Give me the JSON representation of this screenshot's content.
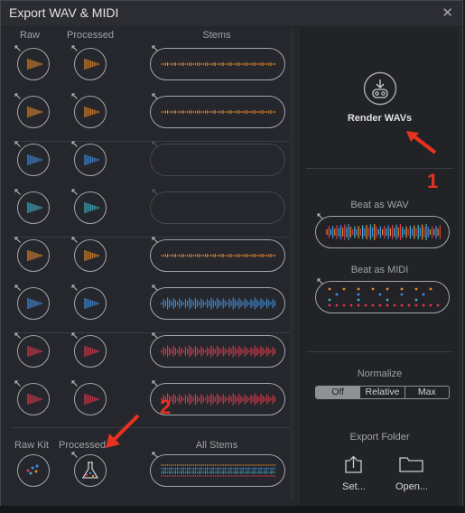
{
  "dialog": {
    "title": "Export WAV & MIDI",
    "close_icon": "close-icon"
  },
  "columns": {
    "raw": "Raw",
    "processed": "Processed",
    "stems": "Stems"
  },
  "rows": [
    {
      "color": "#e8892b",
      "stem": true
    },
    {
      "color": "#e8892b",
      "stem": true
    },
    {
      "color": "#3f8fe0",
      "stem": false
    },
    {
      "color": "#3fb6c9",
      "stem": false
    },
    {
      "color": "#e8892b",
      "stem": true
    },
    {
      "color": "#3f8fe0",
      "stem": true
    },
    {
      "color": "#e0384c",
      "stem": true
    },
    {
      "color": "#e0384c",
      "stem": true
    }
  ],
  "footer": {
    "raw_kit": "Raw Kit",
    "processed_kit": "Processed",
    "all_stems": "All Stems"
  },
  "right": {
    "render_wavs": "Render WAVs",
    "beat_as_wav": "Beat as WAV",
    "beat_as_midi": "Beat as MIDI",
    "normalize": "Normalize",
    "normalize_options": [
      "Off",
      "Relative",
      "Max"
    ],
    "normalize_selected": "Off",
    "export_folder": "Export Folder",
    "set_label": "Set...",
    "open_label": "Open..."
  },
  "annotations": {
    "one": "1",
    "two": "2"
  },
  "colors": {
    "orange": "#e8892b",
    "blue": "#3f8fe0",
    "cyan": "#3fb6c9",
    "red": "#e0384c",
    "annotation": "#e8321f"
  }
}
